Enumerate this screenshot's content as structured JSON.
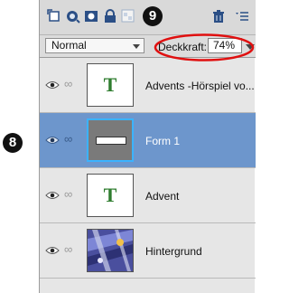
{
  "toolbar": {
    "icons": [
      "new-layer-icon",
      "adjustment-icon",
      "mask-icon",
      "lock-icon",
      "lock-pixels-icon",
      "trash-icon",
      "panel-menu-icon"
    ]
  },
  "options": {
    "blend_mode": "Normal",
    "opacity_label": "Deckkraft:",
    "opacity_value": "74%",
    "opacity_percent": 74
  },
  "layers": [
    {
      "name": "Advents -Hörspiel vo...",
      "type": "text",
      "thumb_letter": "T",
      "selected": false
    },
    {
      "name": "Form 1",
      "type": "shape",
      "selected": true
    },
    {
      "name": "Advent",
      "type": "text",
      "thumb_letter": "T",
      "selected": false
    },
    {
      "name": "Hintergrund",
      "type": "image",
      "selected": false
    }
  ],
  "callouts": {
    "eight": "8",
    "nine": "9"
  },
  "colors": {
    "selection": "#6d96cc",
    "highlight": "#e01010",
    "text_thumb": "#2f7d2f"
  }
}
